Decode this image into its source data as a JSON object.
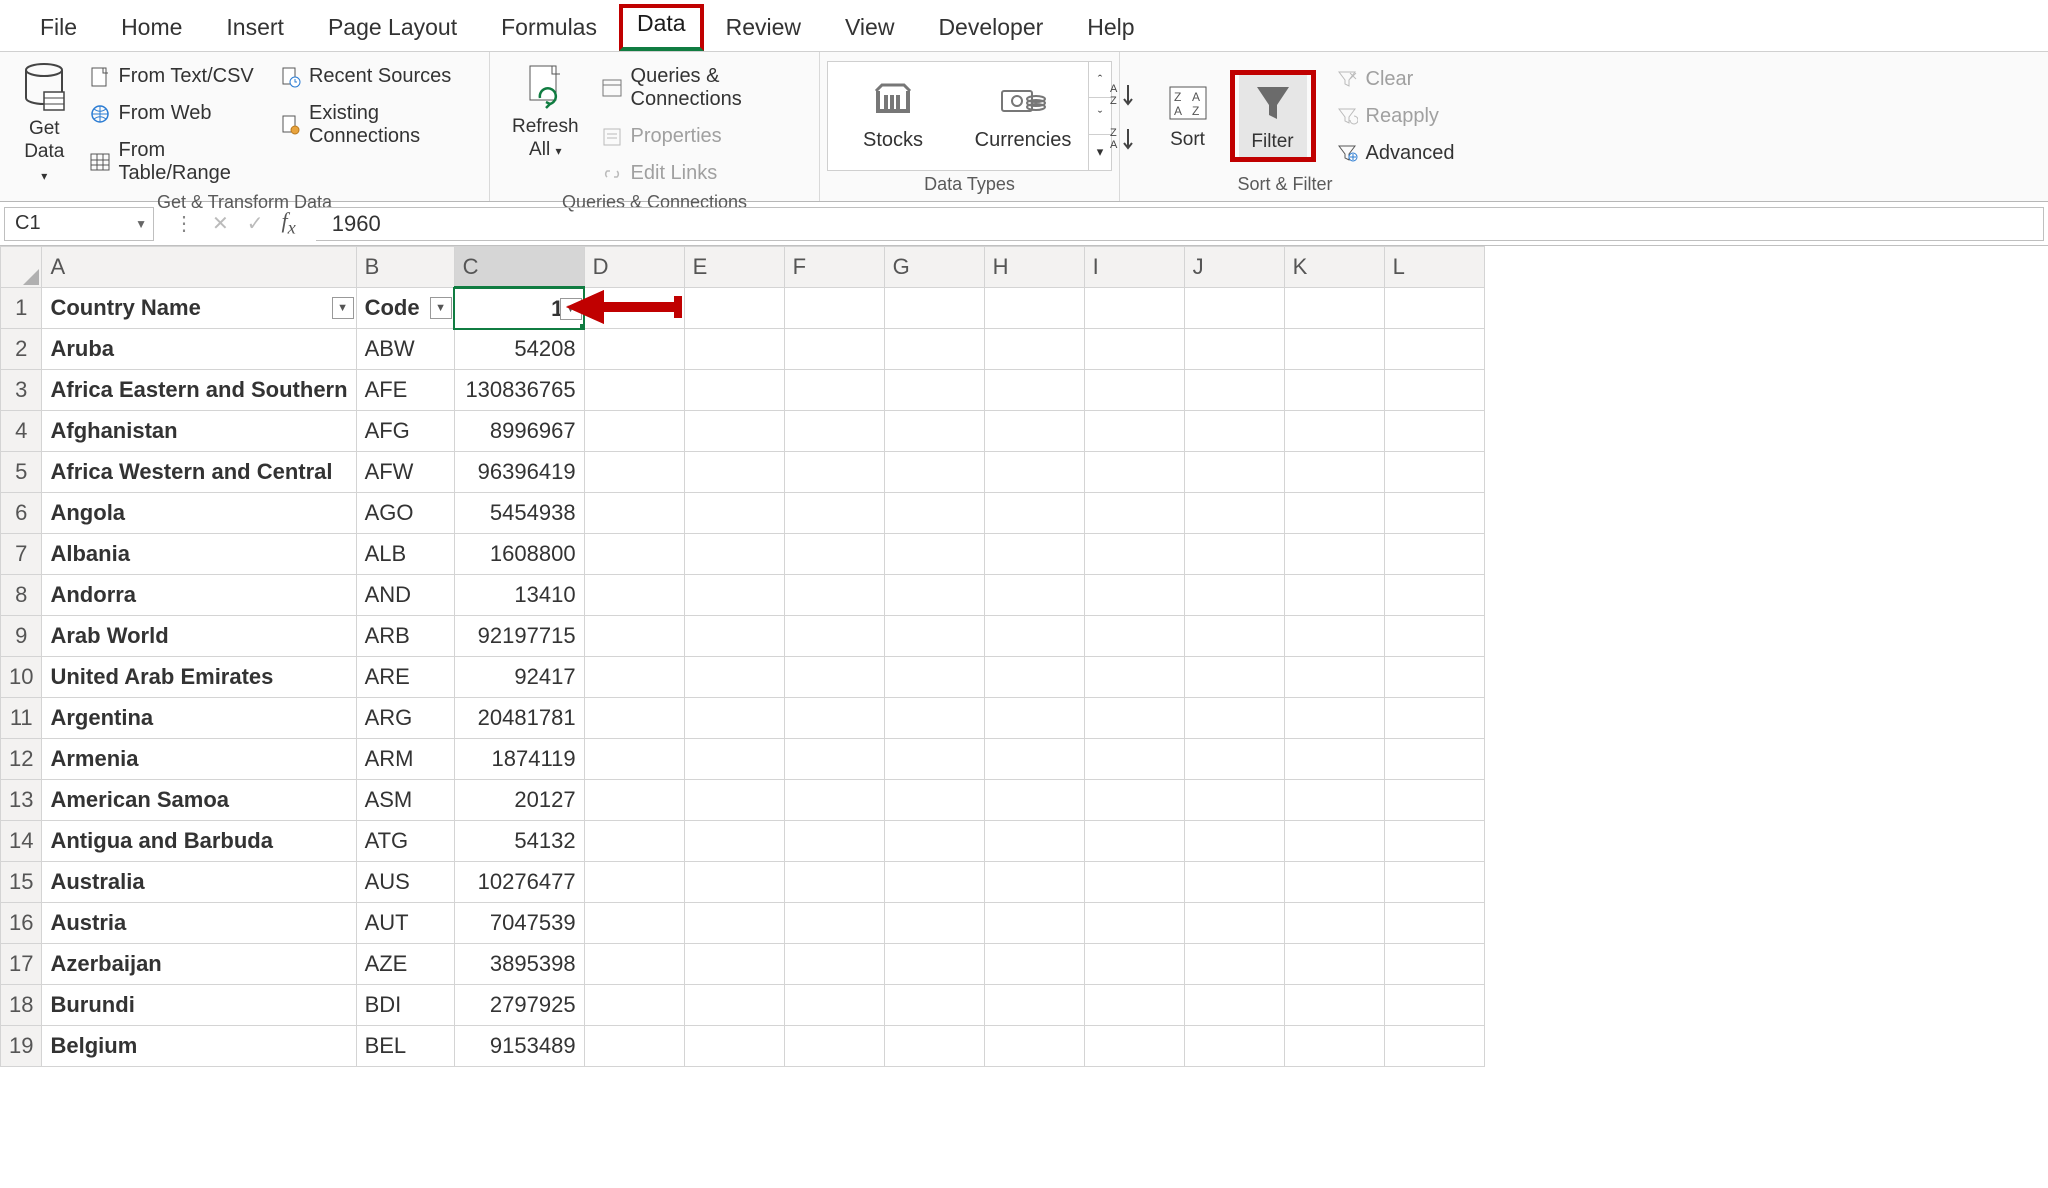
{
  "menu": {
    "tabs": [
      "File",
      "Home",
      "Insert",
      "Page Layout",
      "Formulas",
      "Data",
      "Review",
      "View",
      "Developer",
      "Help"
    ],
    "active": "Data"
  },
  "ribbon": {
    "get_transform": {
      "get_data": "Get\nData",
      "from_text_csv": "From Text/CSV",
      "from_web": "From Web",
      "from_table_range": "From Table/Range",
      "recent_sources": "Recent Sources",
      "existing_connections": "Existing Connections",
      "label": "Get & Transform Data"
    },
    "queries": {
      "refresh_all": "Refresh\nAll",
      "queries_connections": "Queries & Connections",
      "properties": "Properties",
      "edit_links": "Edit Links",
      "label": "Queries & Connections"
    },
    "data_types": {
      "stocks": "Stocks",
      "currencies": "Currencies",
      "label": "Data Types"
    },
    "sort_filter": {
      "sort": "Sort",
      "filter": "Filter",
      "clear": "Clear",
      "reapply": "Reapply",
      "advanced": "Advanced",
      "label": "Sort & Filter"
    }
  },
  "formula_bar": {
    "name_box": "C1",
    "formula": "1960"
  },
  "sheet": {
    "columns": [
      "A",
      "B",
      "C",
      "D",
      "E",
      "F",
      "G",
      "H",
      "I",
      "J",
      "K",
      "L"
    ],
    "headers": {
      "A": "Country Name",
      "B": "Code",
      "C": "19"
    },
    "rows": [
      {
        "n": 2,
        "A": "Aruba",
        "B": "ABW",
        "C": "54208"
      },
      {
        "n": 3,
        "A": "Africa Eastern and Southern",
        "B": "AFE",
        "C": "130836765"
      },
      {
        "n": 4,
        "A": "Afghanistan",
        "B": "AFG",
        "C": "8996967"
      },
      {
        "n": 5,
        "A": "Africa Western and Central",
        "B": "AFW",
        "C": "96396419"
      },
      {
        "n": 6,
        "A": "Angola",
        "B": "AGO",
        "C": "5454938"
      },
      {
        "n": 7,
        "A": "Albania",
        "B": "ALB",
        "C": "1608800"
      },
      {
        "n": 8,
        "A": "Andorra",
        "B": "AND",
        "C": "13410"
      },
      {
        "n": 9,
        "A": "Arab World",
        "B": "ARB",
        "C": "92197715"
      },
      {
        "n": 10,
        "A": "United Arab Emirates",
        "B": "ARE",
        "C": "92417"
      },
      {
        "n": 11,
        "A": "Argentina",
        "B": "ARG",
        "C": "20481781"
      },
      {
        "n": 12,
        "A": "Armenia",
        "B": "ARM",
        "C": "1874119"
      },
      {
        "n": 13,
        "A": "American Samoa",
        "B": "ASM",
        "C": "20127"
      },
      {
        "n": 14,
        "A": "Antigua and Barbuda",
        "B": "ATG",
        "C": "54132"
      },
      {
        "n": 15,
        "A": "Australia",
        "B": "AUS",
        "C": "10276477"
      },
      {
        "n": 16,
        "A": "Austria",
        "B": "AUT",
        "C": "7047539"
      },
      {
        "n": 17,
        "A": "Azerbaijan",
        "B": "AZE",
        "C": "3895398"
      },
      {
        "n": 18,
        "A": "Burundi",
        "B": "BDI",
        "C": "2797925"
      },
      {
        "n": 19,
        "A": "Belgium",
        "B": "BEL",
        "C": "9153489"
      }
    ]
  }
}
